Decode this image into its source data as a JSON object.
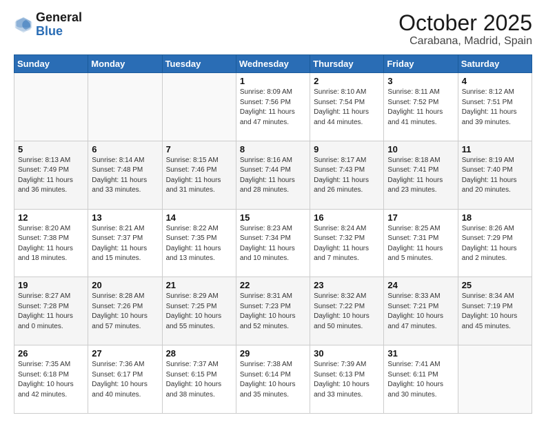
{
  "logo": {
    "line1": "General",
    "line2": "Blue"
  },
  "title": "October 2025",
  "subtitle": "Carabana, Madrid, Spain",
  "days_of_week": [
    "Sunday",
    "Monday",
    "Tuesday",
    "Wednesday",
    "Thursday",
    "Friday",
    "Saturday"
  ],
  "weeks": [
    [
      {
        "day": "",
        "info": ""
      },
      {
        "day": "",
        "info": ""
      },
      {
        "day": "",
        "info": ""
      },
      {
        "day": "1",
        "info": "Sunrise: 8:09 AM\nSunset: 7:56 PM\nDaylight: 11 hours\nand 47 minutes."
      },
      {
        "day": "2",
        "info": "Sunrise: 8:10 AM\nSunset: 7:54 PM\nDaylight: 11 hours\nand 44 minutes."
      },
      {
        "day": "3",
        "info": "Sunrise: 8:11 AM\nSunset: 7:52 PM\nDaylight: 11 hours\nand 41 minutes."
      },
      {
        "day": "4",
        "info": "Sunrise: 8:12 AM\nSunset: 7:51 PM\nDaylight: 11 hours\nand 39 minutes."
      }
    ],
    [
      {
        "day": "5",
        "info": "Sunrise: 8:13 AM\nSunset: 7:49 PM\nDaylight: 11 hours\nand 36 minutes."
      },
      {
        "day": "6",
        "info": "Sunrise: 8:14 AM\nSunset: 7:48 PM\nDaylight: 11 hours\nand 33 minutes."
      },
      {
        "day": "7",
        "info": "Sunrise: 8:15 AM\nSunset: 7:46 PM\nDaylight: 11 hours\nand 31 minutes."
      },
      {
        "day": "8",
        "info": "Sunrise: 8:16 AM\nSunset: 7:44 PM\nDaylight: 11 hours\nand 28 minutes."
      },
      {
        "day": "9",
        "info": "Sunrise: 8:17 AM\nSunset: 7:43 PM\nDaylight: 11 hours\nand 26 minutes."
      },
      {
        "day": "10",
        "info": "Sunrise: 8:18 AM\nSunset: 7:41 PM\nDaylight: 11 hours\nand 23 minutes."
      },
      {
        "day": "11",
        "info": "Sunrise: 8:19 AM\nSunset: 7:40 PM\nDaylight: 11 hours\nand 20 minutes."
      }
    ],
    [
      {
        "day": "12",
        "info": "Sunrise: 8:20 AM\nSunset: 7:38 PM\nDaylight: 11 hours\nand 18 minutes."
      },
      {
        "day": "13",
        "info": "Sunrise: 8:21 AM\nSunset: 7:37 PM\nDaylight: 11 hours\nand 15 minutes."
      },
      {
        "day": "14",
        "info": "Sunrise: 8:22 AM\nSunset: 7:35 PM\nDaylight: 11 hours\nand 13 minutes."
      },
      {
        "day": "15",
        "info": "Sunrise: 8:23 AM\nSunset: 7:34 PM\nDaylight: 11 hours\nand 10 minutes."
      },
      {
        "day": "16",
        "info": "Sunrise: 8:24 AM\nSunset: 7:32 PM\nDaylight: 11 hours\nand 7 minutes."
      },
      {
        "day": "17",
        "info": "Sunrise: 8:25 AM\nSunset: 7:31 PM\nDaylight: 11 hours\nand 5 minutes."
      },
      {
        "day": "18",
        "info": "Sunrise: 8:26 AM\nSunset: 7:29 PM\nDaylight: 11 hours\nand 2 minutes."
      }
    ],
    [
      {
        "day": "19",
        "info": "Sunrise: 8:27 AM\nSunset: 7:28 PM\nDaylight: 11 hours\nand 0 minutes."
      },
      {
        "day": "20",
        "info": "Sunrise: 8:28 AM\nSunset: 7:26 PM\nDaylight: 10 hours\nand 57 minutes."
      },
      {
        "day": "21",
        "info": "Sunrise: 8:29 AM\nSunset: 7:25 PM\nDaylight: 10 hours\nand 55 minutes."
      },
      {
        "day": "22",
        "info": "Sunrise: 8:31 AM\nSunset: 7:23 PM\nDaylight: 10 hours\nand 52 minutes."
      },
      {
        "day": "23",
        "info": "Sunrise: 8:32 AM\nSunset: 7:22 PM\nDaylight: 10 hours\nand 50 minutes."
      },
      {
        "day": "24",
        "info": "Sunrise: 8:33 AM\nSunset: 7:21 PM\nDaylight: 10 hours\nand 47 minutes."
      },
      {
        "day": "25",
        "info": "Sunrise: 8:34 AM\nSunset: 7:19 PM\nDaylight: 10 hours\nand 45 minutes."
      }
    ],
    [
      {
        "day": "26",
        "info": "Sunrise: 7:35 AM\nSunset: 6:18 PM\nDaylight: 10 hours\nand 42 minutes."
      },
      {
        "day": "27",
        "info": "Sunrise: 7:36 AM\nSunset: 6:17 PM\nDaylight: 10 hours\nand 40 minutes."
      },
      {
        "day": "28",
        "info": "Sunrise: 7:37 AM\nSunset: 6:15 PM\nDaylight: 10 hours\nand 38 minutes."
      },
      {
        "day": "29",
        "info": "Sunrise: 7:38 AM\nSunset: 6:14 PM\nDaylight: 10 hours\nand 35 minutes."
      },
      {
        "day": "30",
        "info": "Sunrise: 7:39 AM\nSunset: 6:13 PM\nDaylight: 10 hours\nand 33 minutes."
      },
      {
        "day": "31",
        "info": "Sunrise: 7:41 AM\nSunset: 6:11 PM\nDaylight: 10 hours\nand 30 minutes."
      },
      {
        "day": "",
        "info": ""
      }
    ]
  ]
}
